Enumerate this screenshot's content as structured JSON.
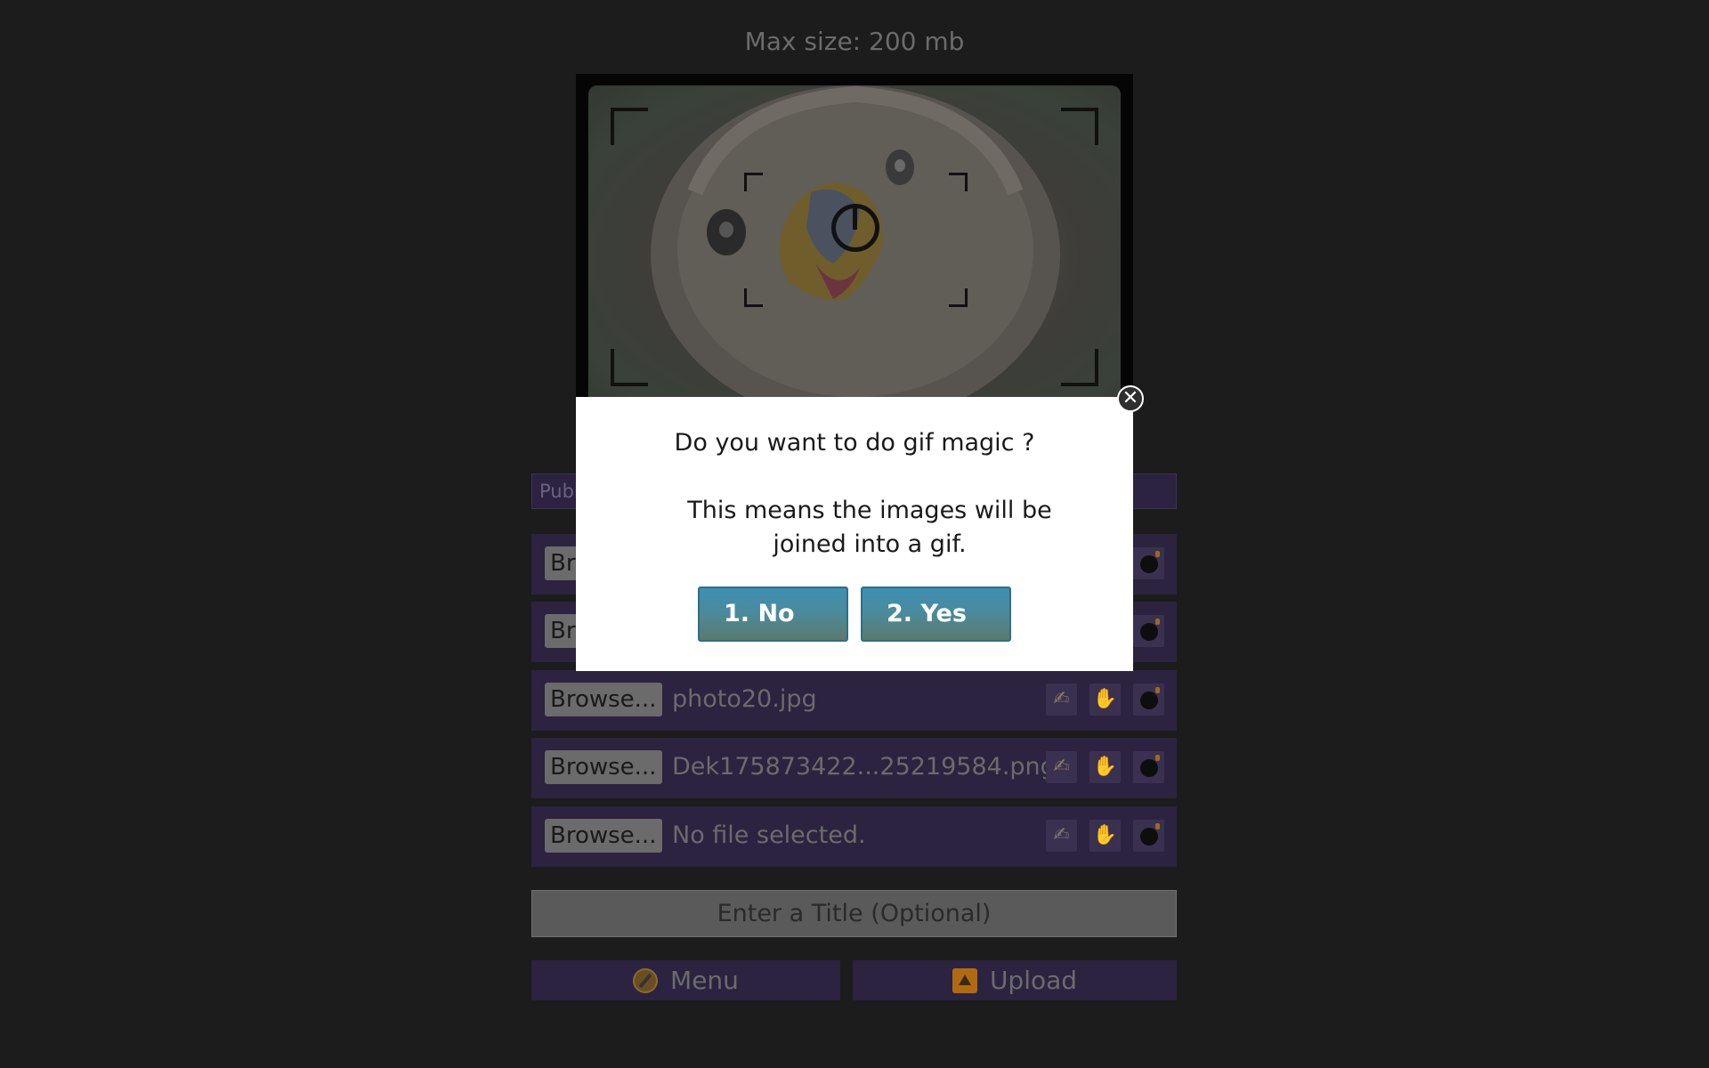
{
  "header": {
    "max_size": "Max size: 200 mb"
  },
  "visibility_field": {
    "placeholder": "Publ"
  },
  "file_rows": [
    {
      "browse_label": "Br",
      "file_name": ""
    },
    {
      "browse_label": "Br",
      "file_name": ""
    },
    {
      "browse_label": "Browse...",
      "file_name": "photo20.jpg"
    },
    {
      "browse_label": "Browse...",
      "file_name": "Dek175873422...25219584.png"
    },
    {
      "browse_label": "Browse...",
      "file_name": "No file selected."
    }
  ],
  "row_tools": {
    "edit_icon": "pencil-icon",
    "hand_icon": "hand-icon",
    "delete_icon": "bomb-icon",
    "edit_glyph": "✍",
    "hand_glyph": "✋"
  },
  "title_field": {
    "placeholder": "Enter a Title (Optional)"
  },
  "bottom_bar": {
    "menu_label": "Menu",
    "upload_label": "Upload"
  },
  "dialog": {
    "question": "Do you want to do gif magic ?",
    "info": "This means the images will be joined into a gif.",
    "no_label": "1. No",
    "yes_label": "2. Yes",
    "close_glyph": "✕"
  },
  "colors": {
    "background": "#1c1c1c",
    "row_background": "#2b2340",
    "dialog_button": "#3e8fb3"
  }
}
